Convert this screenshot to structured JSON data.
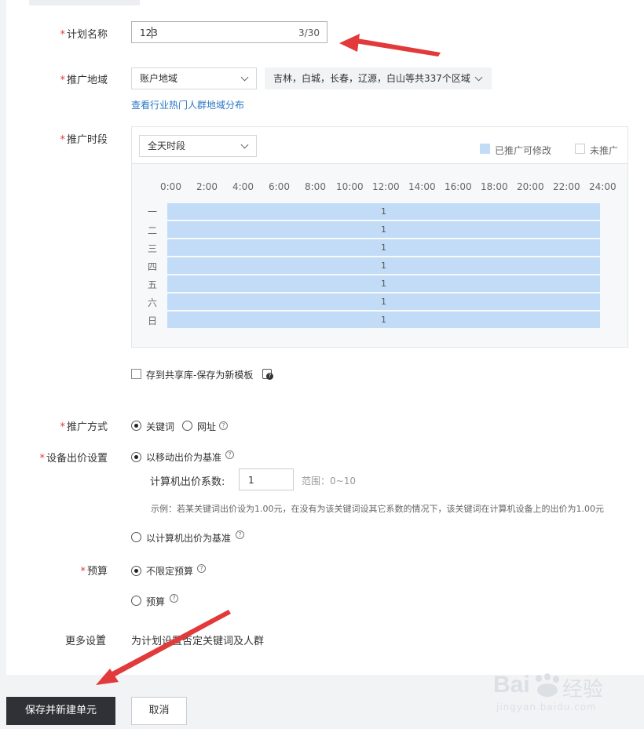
{
  "plan_name": {
    "label": "计划名称",
    "value": "123",
    "counter": "3/30"
  },
  "region": {
    "label": "推广地域",
    "mode_select": "账户地域",
    "regions_select": "吉林，白城，长春，辽源，白山等共337个区域",
    "link": "查看行业热门人群地域分布"
  },
  "schedule": {
    "label": "推广时段",
    "select": "全天时段",
    "legend_editable": "已推广可修改",
    "legend_unpromoted": "未推广",
    "hours": [
      "0:00",
      "2:00",
      "4:00",
      "6:00",
      "8:00",
      "10:00",
      "12:00",
      "14:00",
      "16:00",
      "18:00",
      "20:00",
      "22:00",
      "24:00"
    ],
    "days": [
      "一",
      "二",
      "三",
      "四",
      "五",
      "六",
      "日"
    ],
    "row_values": [
      "1",
      "1",
      "1",
      "1",
      "1",
      "1",
      "1"
    ],
    "colors": {
      "promoted": "#c2dcf7",
      "accent": "#2b77c4"
    }
  },
  "template": {
    "checkbox_label": "存到共享库-保存为新模板"
  },
  "promo_method": {
    "label": "推广方式",
    "option_keyword": "关键词",
    "option_url": "网址"
  },
  "device_bid": {
    "label": "设备出价设置",
    "option_mobile": "以移动出价为基准",
    "coef_label": "计算机出价系数:",
    "coef_value": "1",
    "range": "范围：0~10",
    "example": "示例：若某关键词出价设为1.00元，在没有为该关键词设其它系数的情况下，该关键词在计算机设备上的出价为1.00元",
    "option_pc": "以计算机出价为基准"
  },
  "budget": {
    "label": "预算",
    "option_unlimited": "不限定预算",
    "option_budget": "预算"
  },
  "more": {
    "label": "更多设置",
    "desc": "为计划设置否定关键词及人群"
  },
  "footer": {
    "save_new_unit": "保存并新建单元",
    "cancel": "取消"
  },
  "watermark": {
    "brand": "Bai",
    "brand_cn": "经验",
    "site": "jingyan.baidu.com"
  }
}
